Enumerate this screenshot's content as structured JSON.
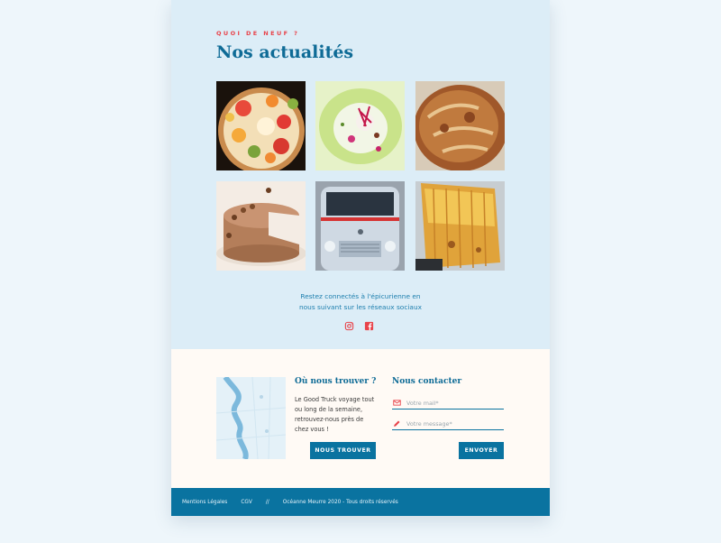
{
  "news": {
    "kicker": "QUOI DE NEUF ?",
    "title": "Nos actualités",
    "photos": [
      "fruit-tart-photo",
      "plated-dessert-photo",
      "bread-loaf-photo",
      "chocolate-cake-photo",
      "food-truck-photo",
      "grilled-bread-photo"
    ],
    "social_text_line1": "Restez connectés à l'épicurienne en",
    "social_text_line2": "nous suivant sur les réseaux sociaux",
    "icons": {
      "instagram": "instagram-icon",
      "facebook": "facebook-icon"
    }
  },
  "find": {
    "title": "Où nous trouver ?",
    "text": "Le Good Truck voyage tout ou long de la semaine, retrouvez-nous près de chez vous !",
    "button": "NOUS TROUVER"
  },
  "contact": {
    "title": "Nous contacter",
    "mail_placeholder": "Votre mail*",
    "message_placeholder": "Votre message*",
    "button": "ENVOYER",
    "icons": {
      "mail": "mail-icon",
      "message": "pencil-icon"
    }
  },
  "footer": {
    "legal": "Mentions Légales",
    "cgv": "CGV",
    "separator": "//",
    "copyright": "Océanne Meurre 2020 - Tous droits réservés"
  },
  "colors": {
    "accent": "#e8434a",
    "brand_blue": "#0e6b96",
    "button_blue": "#0a73a0",
    "news_background": "#dcedf7",
    "page_background": "#eef6fb"
  }
}
